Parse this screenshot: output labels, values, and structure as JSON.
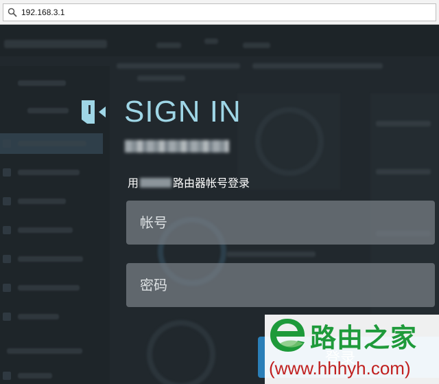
{
  "browser": {
    "url": "192.168.3.1",
    "search_icon": "magnifier-icon"
  },
  "login": {
    "icon": "sign-in-door-icon",
    "title": "SIGN IN",
    "subtitle_prefix": "用",
    "subtitle_suffix": "路由器帐号登录",
    "username_placeholder": "帐号",
    "password_placeholder": "密码",
    "login_button": "登录"
  },
  "watermark": {
    "logo_icon": "e-leaf-logo-icon",
    "name": "路由之家",
    "url": "(www.hhhyh.com)"
  },
  "colors": {
    "title": "#9fd6e6",
    "button": "#2a7fb8",
    "watermark_green": "#1e9a3a",
    "watermark_red": "#c0201f"
  }
}
